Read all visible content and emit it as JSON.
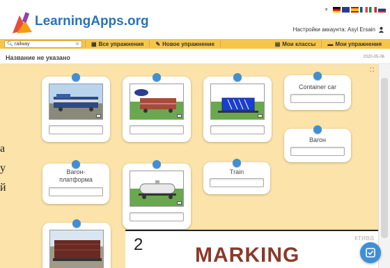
{
  "header": {
    "logo_text": "LearningApps.org",
    "account_label": "Настройки аккаунта: Asyl Ersain"
  },
  "toolbar": {
    "search_value": "railway",
    "all_exercises": "Все упражнения",
    "new_exercise": "Новое упражнение",
    "my_classes": "Мои классы",
    "my_exercises": "Мои упражнения"
  },
  "page": {
    "title": "Название не указано",
    "date": "2020-05-06"
  },
  "cards": [
    {
      "type": "image",
      "image": "locomotive"
    },
    {
      "type": "image",
      "image": "car-carrier"
    },
    {
      "type": "image",
      "image": "container-car"
    },
    {
      "type": "text",
      "label": "Container car"
    },
    {
      "type": "text",
      "label": "Вагон"
    },
    {
      "type": "text",
      "label": "Вагон-платформа"
    },
    {
      "type": "image",
      "image": "tank-car"
    },
    {
      "type": "text",
      "label": "Train"
    },
    {
      "type": "image",
      "image": "hopper-car"
    }
  ],
  "bottom": {
    "number": "2",
    "heading": "MARKING",
    "watermark": "ктива"
  },
  "left_strip": [
    "а",
    "у",
    "й"
  ],
  "colors": {
    "toolbar": "#f5c64a",
    "board": "#fbe3a9",
    "pin": "#3f8fd6",
    "logo": "#2a73b8"
  }
}
